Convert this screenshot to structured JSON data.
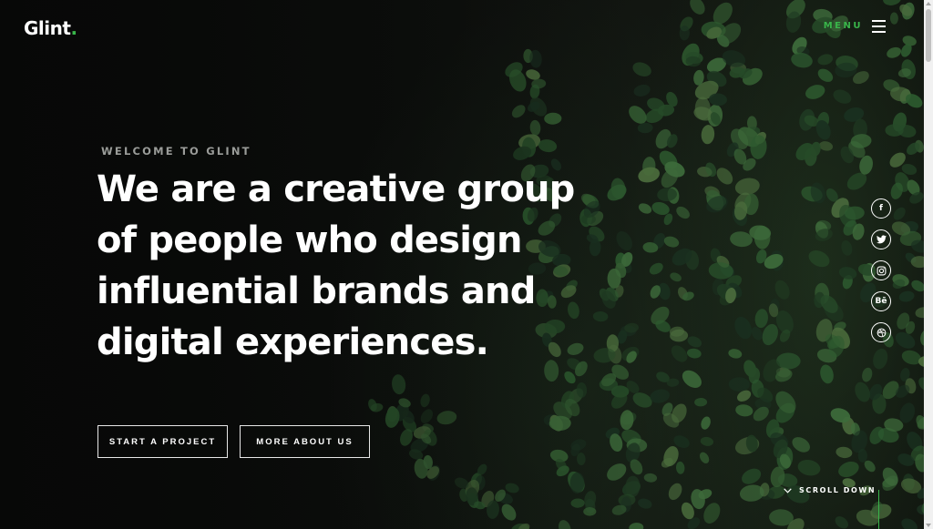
{
  "header": {
    "logo_text": "Glint",
    "logo_dot": ".",
    "menu_label": "MENU",
    "menu_icon": "hamburger-icon"
  },
  "hero": {
    "eyebrow": "WELCOME TO GLINT",
    "headline": "We are a creative group of people who design influential brands and digital experiences.",
    "buttons": {
      "start": "START A PROJECT",
      "more": "MORE ABOUT US"
    }
  },
  "social": [
    {
      "icon": "facebook-icon",
      "glyph": "f"
    },
    {
      "icon": "twitter-icon",
      "glyph": ""
    },
    {
      "icon": "instagram-icon",
      "glyph": ""
    },
    {
      "icon": "behance-icon",
      "glyph": "Bē"
    },
    {
      "icon": "dribbble-icon",
      "glyph": ""
    }
  ],
  "scroll": {
    "label": "SCROLL DOWN",
    "icon": "chevron-down-icon"
  },
  "colors": {
    "accent": "#39b54a",
    "text": "#ffffff",
    "muted": "#9a9c99",
    "background": "#0b0c0b"
  }
}
